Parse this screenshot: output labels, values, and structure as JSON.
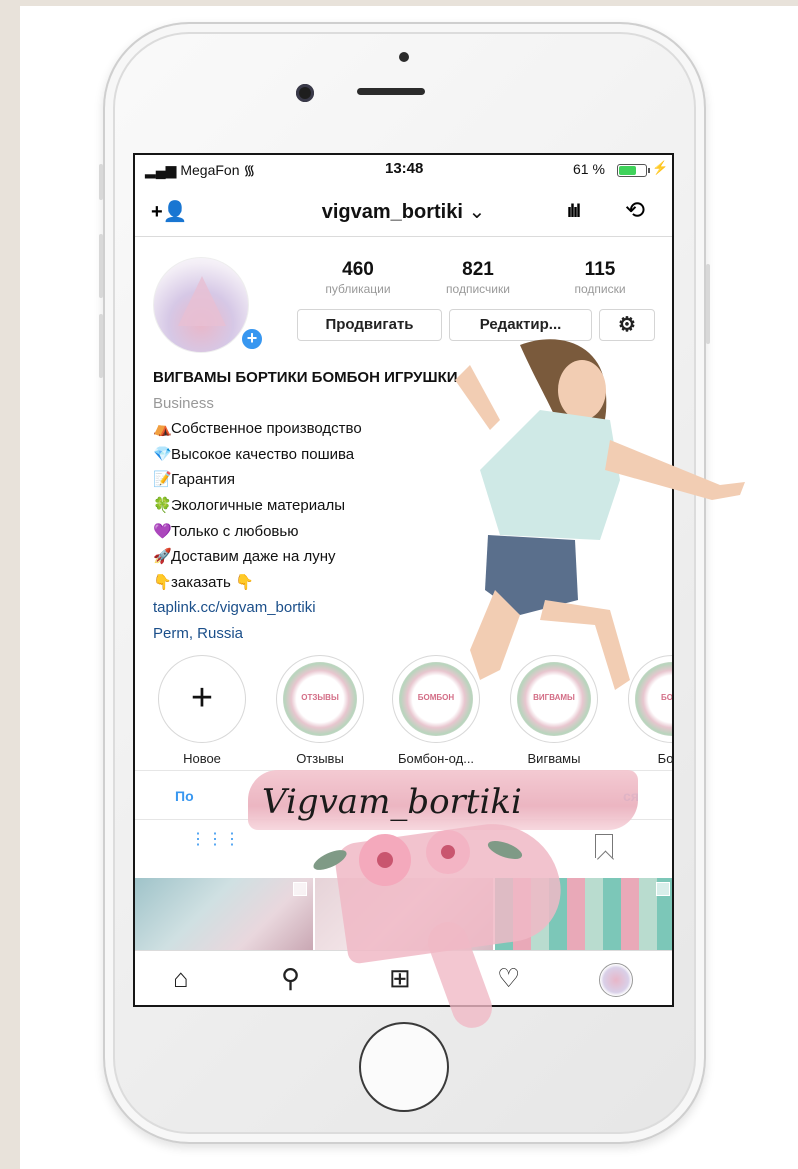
{
  "status_bar": {
    "carrier": "MegaFon",
    "time": "13:48",
    "battery_percent": "61 %",
    "battery_level": 0.61,
    "wifi_icon": "wifi-icon",
    "signal_icon": "signal-bars-icon",
    "charging_icon": "bolt-icon"
  },
  "navbar": {
    "add_person_icon": "add-person-icon",
    "username": "vigvam_bortiki",
    "username_chevron": "⌄",
    "insights_icon": "bar-chart-icon",
    "archive_icon": "history-clock-icon"
  },
  "profile": {
    "stats": [
      {
        "value": "460",
        "label": "публикации"
      },
      {
        "value": "821",
        "label": "подписчики"
      },
      {
        "value": "115",
        "label": "подписки"
      }
    ],
    "buttons": {
      "promote": "Продвигать",
      "edit": "Редактир...",
      "settings_icon": "gear-icon"
    }
  },
  "bio": {
    "name": "ВИГВАМЫ БОРТИКИ БОМБОН ИГРУШКИ",
    "category": "Business",
    "lines": [
      {
        "emoji": "⛺",
        "text": "Собственное производство"
      },
      {
        "emoji": "💎",
        "text": "Высокое качество пошива"
      },
      {
        "emoji": "📝",
        "text": "Гарантия"
      },
      {
        "emoji": "🍀",
        "text": "Экологичные материалы"
      },
      {
        "emoji": "💜",
        "text": "Только с любовью"
      },
      {
        "emoji": "🚀",
        "text": "Доставим даже на луну"
      },
      {
        "emoji": "👇",
        "text": "заказать 👇"
      }
    ],
    "link": "taplink.cc/vigvam_bortiki",
    "location": "Perm, Russia"
  },
  "highlights": [
    {
      "label": "Новое",
      "badge": ""
    },
    {
      "label": "Отзывы",
      "badge": "ОТЗЫВЫ"
    },
    {
      "label": "Бомбон-од...",
      "badge": "БОМБОН"
    },
    {
      "label": "Вигвамы",
      "badge": "ВИГВАМЫ"
    },
    {
      "label": "Борт",
      "badge": "БОРТ"
    }
  ],
  "promo_bar": {
    "left_text": "По",
    "right_text": "ся"
  },
  "content_tabs": {
    "grid_icon": "grid-icon",
    "saved_icon": "bookmark-icon"
  },
  "tab_bar": {
    "home_icon": "home-icon",
    "search_icon": "search-icon",
    "new_post_icon": "plus-square-icon",
    "activity_icon": "heart-icon",
    "profile_icon": "avatar"
  },
  "overlay": {
    "signature": "Vigvam_bortiki"
  },
  "colors": {
    "accent": "#3897f0",
    "link": "#1b4f8a",
    "brush_pink": "#f0b9c5",
    "battery_green": "#3fd25a"
  }
}
